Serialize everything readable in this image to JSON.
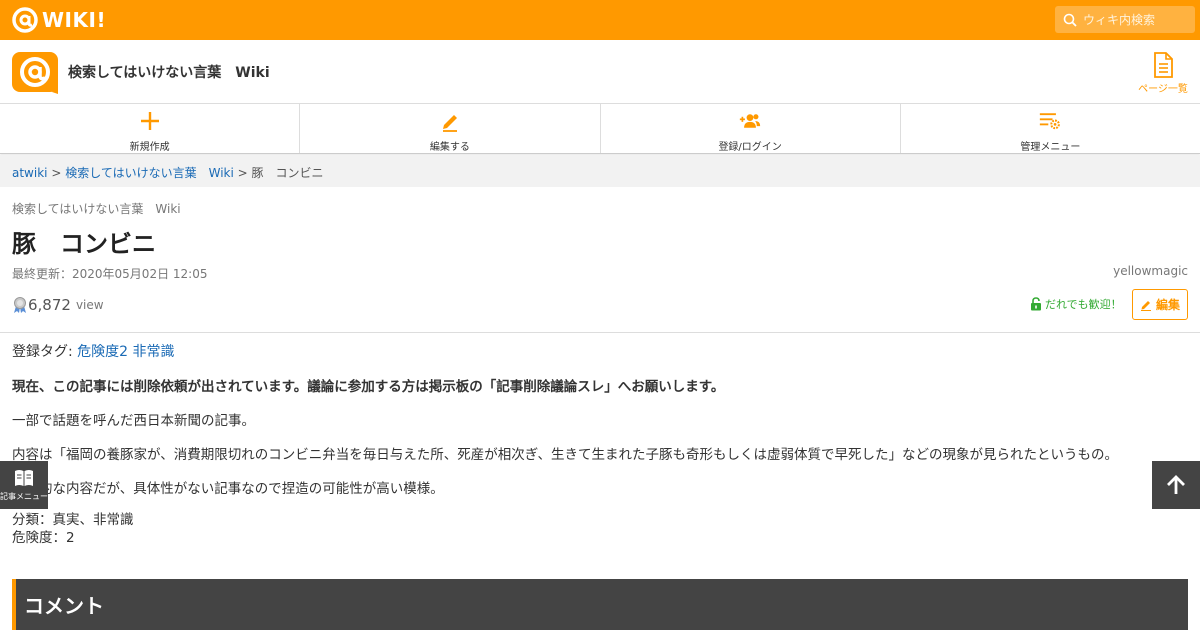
{
  "topbar": {
    "logo_text": "WIKI!",
    "search_placeholder": "ウィキ内検索"
  },
  "site": {
    "title": "検索してはいけない言葉　Wiki",
    "page_list_label": "ページ一覧"
  },
  "actions": [
    {
      "label": "新規作成",
      "icon": "plus-icon"
    },
    {
      "label": "編集する",
      "icon": "pencil-icon"
    },
    {
      "label": "登録/ログイン",
      "icon": "user-add-icon"
    },
    {
      "label": "管理メニュー",
      "icon": "settings-list-icon"
    }
  ],
  "breadcrumb": {
    "root": "atwiki",
    "sep1": " > ",
    "wiki": "検索してはいけない言葉　Wiki",
    "sep2": " > ",
    "current": "豚　コンビニ"
  },
  "page": {
    "wiki_name": "検索してはいけない言葉　Wiki",
    "title": "豚　コンビニ",
    "last_update": "最終更新：2020年05月02日 12:05",
    "author": "yellowmagic",
    "views": "6,872",
    "views_label": "view",
    "welcome": "だれでも歓迎！",
    "edit_label": "編集"
  },
  "content": {
    "tags_label": "登録タグ: ",
    "tag1": "危険度2",
    "tag2": "非常識",
    "notice": "現在、この記事には削除依頼が出されています。議論に参加する方は掲示板の「記事削除議論スレ」へお願いします。",
    "intro": "一部で話題を呼んだ西日本新聞の記事。",
    "body": "内容は「福岡の養豚家が、消費期限切れのコンビニ弁当を毎日与えた所、死産が相次ぎ、生きて生まれた子豚も奇形もしくは虚弱体質で早死した」などの現象が見られたというもの。",
    "note": "衝撃的な内容だが、具体性がない記事なので捏造の可能性が高い模様。",
    "category": "分類：真実、非常識",
    "danger": "危険度：2"
  },
  "comment_heading": "コメント",
  "floating": {
    "article_menu": "記事メニュー"
  },
  "colors": {
    "brand": "#ff9900",
    "link": "#1a6ab5",
    "welcome": "#33aa33",
    "dark": "#444444"
  }
}
